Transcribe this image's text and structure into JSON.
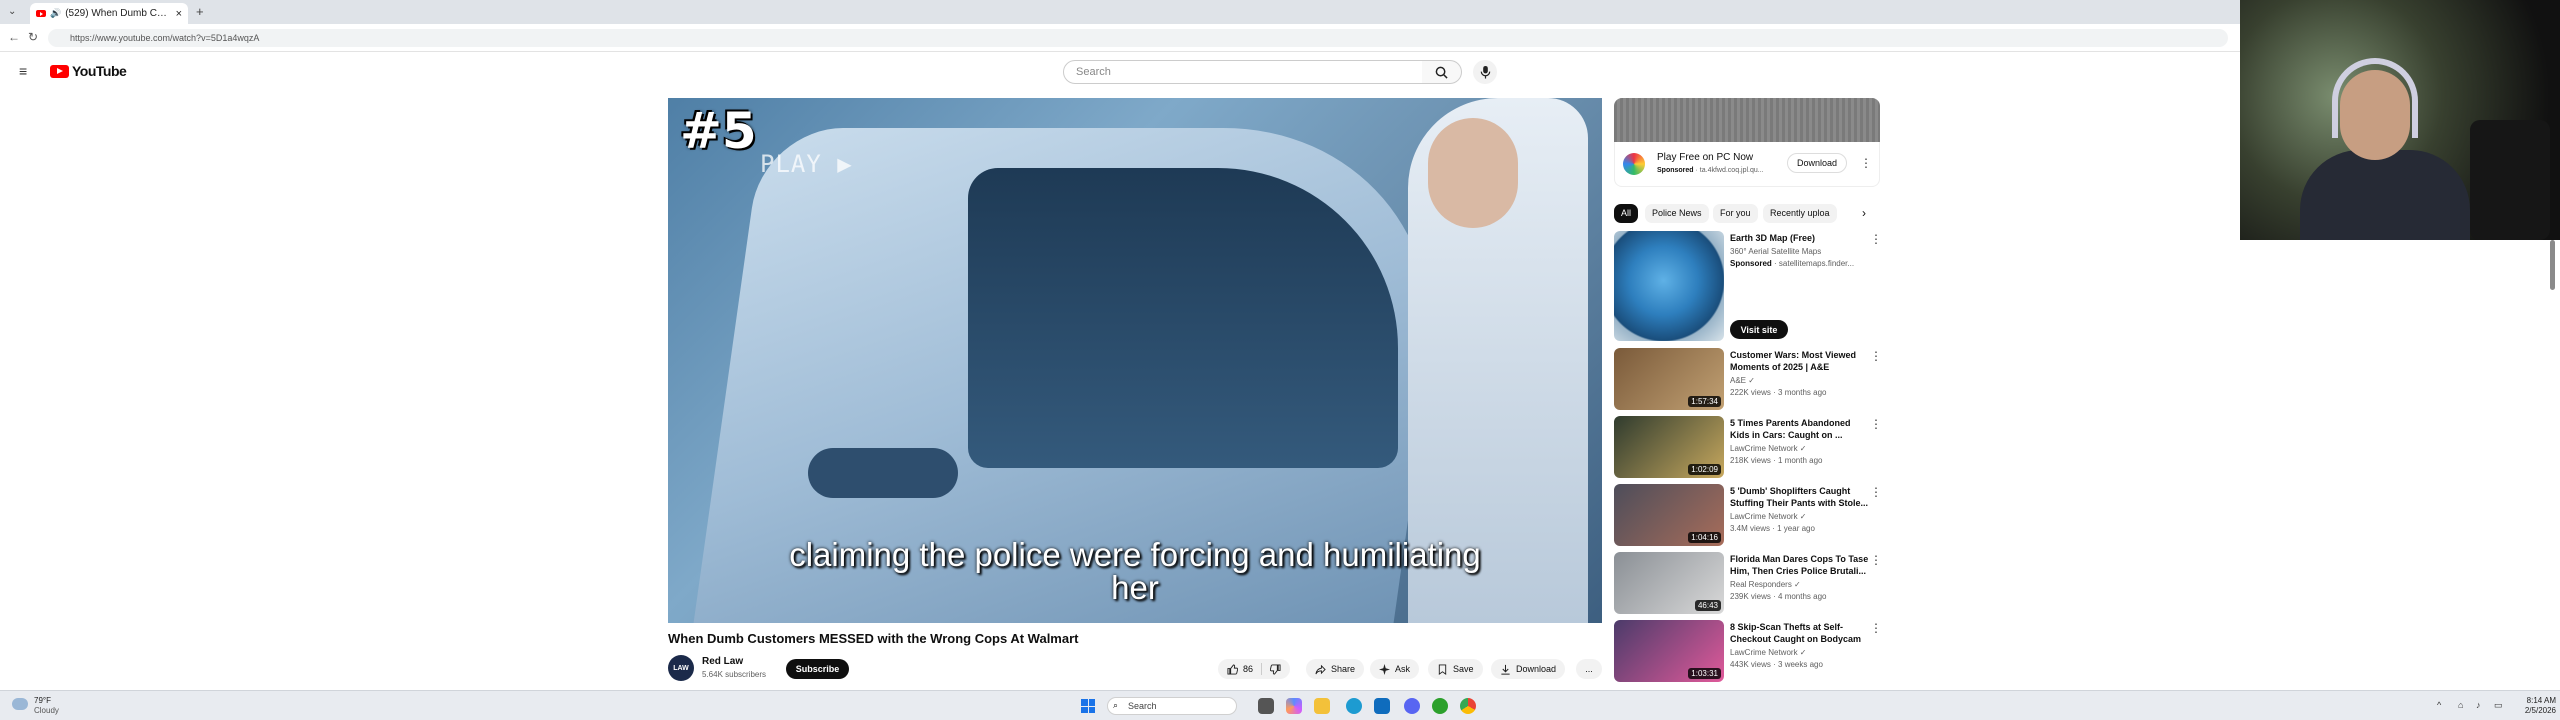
{
  "browser": {
    "tab_title": "(529) When Dumb Customers...",
    "new_tab": "+",
    "url": "https://www.youtube.com/watch?v=5D1a4wqzA"
  },
  "masthead": {
    "logo_text": "YouTube",
    "search_placeholder": "Search"
  },
  "video": {
    "badge": "#5",
    "overlay_text": "PLAY ▶",
    "caption_line1": "claiming the police were forcing and humiliating",
    "caption_line2": "her",
    "title": "When Dumb Customers MESSED with the Wrong Cops At Walmart",
    "channel": {
      "avatar_text": "LAW",
      "name": "Red Law",
      "subscribers": "5.64K subscribers"
    },
    "subscribe_label": "Subscribe",
    "actions": {
      "like_count": "86",
      "share": "Share",
      "ask": "Ask",
      "save": "Save",
      "download": "Download",
      "more": "..."
    }
  },
  "sidebar": {
    "ad": {
      "title": "Play Free on PC Now",
      "sponsored": "Sponsored",
      "advertiser": "· ta.4kfwd.coq.jpl.qu...",
      "button": "Download"
    },
    "chips": [
      "All",
      "Police News",
      "For you",
      "Recently uploa"
    ],
    "rec_ad": {
      "title": "Earth 3D Map (Free)",
      "line2": "360° Aerial Satellite Maps",
      "sponsored": "Sponsored",
      "line3": "· satellitemaps.finder...",
      "button": "Visit site"
    },
    "videos": [
      {
        "title": "Customer Wars: Most Viewed Moments of 2025 | A&E",
        "channel": "A&E ✓",
        "meta": "222K views · 3 months ago",
        "duration": "1:57:34",
        "c1": "#7a5a3a",
        "c2": "#c2a173"
      },
      {
        "title": "5 Times Parents Abandoned Kids in Cars: Caught on ...",
        "channel": "LawCrime Network ✓",
        "meta": "218K views · 1 month ago",
        "duration": "1:02:09",
        "c1": "#2f3b2e",
        "c2": "#c7a85e"
      },
      {
        "title": "5 'Dumb' Shoplifters Caught Stuffing Their Pants with Stole...",
        "channel": "LawCrime Network ✓",
        "meta": "3.4M views · 1 year ago",
        "duration": "1:04:16",
        "c1": "#4d4d5a",
        "c2": "#a86d5a"
      },
      {
        "title": "Florida Man Dares Cops To Tase Him, Then Cries Police Brutali...",
        "channel": "Real Responders ✓",
        "meta": "239K views · 4 months ago",
        "duration": "46:43",
        "c1": "#8a8f95",
        "c2": "#d9d9d9"
      },
      {
        "title": "8 Skip-Scan Thefts at Self-Checkout Caught on Bodycam",
        "channel": "LawCrime Network ✓",
        "meta": "443K views · 3 weeks ago",
        "duration": "1:03:31",
        "c1": "#4b3b6a",
        "c2": "#e05a9a"
      }
    ]
  },
  "taskbar": {
    "temp": "79°F",
    "condition": "Cloudy",
    "search": "Search",
    "time": "8:14 AM",
    "date": "2/5/2026"
  },
  "colors": {
    "brand_red": "#ff0000",
    "subscribe_bg": "#0f0f0f"
  }
}
